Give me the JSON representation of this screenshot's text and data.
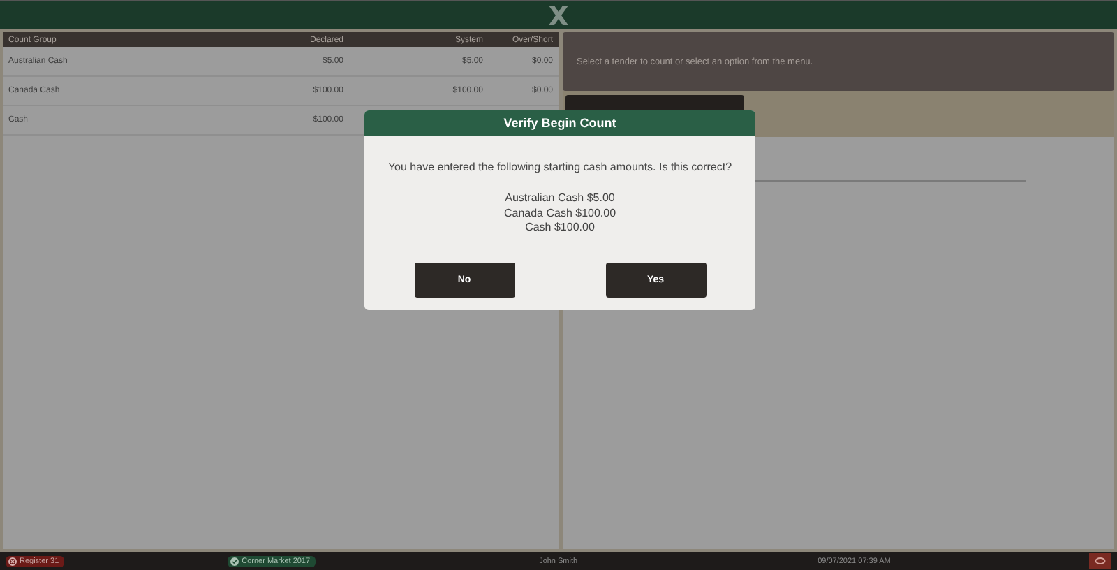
{
  "table": {
    "columns": [
      "Count Group",
      "Declared",
      "System",
      "Over/Short"
    ],
    "rows": [
      [
        "Australian Cash",
        "$5.00",
        "$5.00",
        "$0.00"
      ],
      [
        "Canada Cash",
        "$100.00",
        "$100.00",
        "$0.00"
      ],
      [
        "Cash",
        "$100.00",
        "",
        ""
      ]
    ]
  },
  "prompt": "Select a tender to count or select an option from the menu.",
  "dialog": {
    "title": "Verify Begin Count",
    "message": "You have entered the following starting cash amounts. Is this correct?",
    "lines": [
      "Australian Cash $5.00",
      "Canada Cash $100.00",
      "Cash $100.00"
    ],
    "buttons": [
      "No",
      "Yes"
    ]
  },
  "status_bar": {
    "register": "Register 31",
    "store": "Corner Market 2017",
    "user": "John Smith",
    "datetime": "09/07/2021 07:39 AM"
  }
}
